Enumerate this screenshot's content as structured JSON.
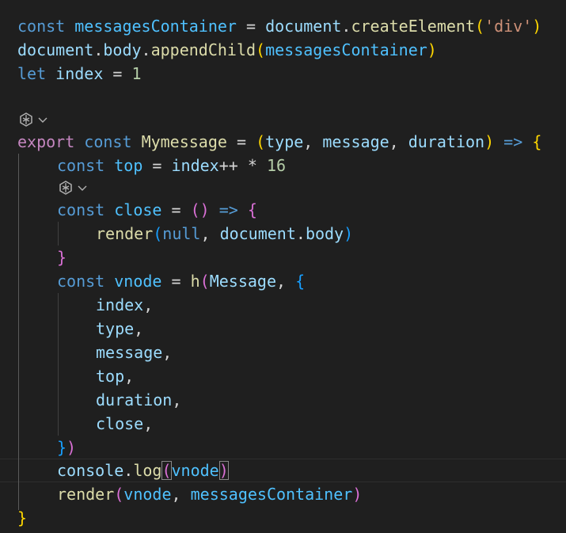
{
  "editor": {
    "line1": {
      "kw": "const",
      "name": "messagesContainer",
      "eq": " = ",
      "obj": "document",
      "dot": ".",
      "fn": "createElement",
      "open": "(",
      "str": "'div'",
      "close": ")"
    },
    "line2": {
      "obj": "document",
      "dot1": ".",
      "prop": "body",
      "dot2": ".",
      "fn": "appendChild",
      "open": "(",
      "arg": "messagesContainer",
      "close": ")"
    },
    "line3": {
      "kw": "let",
      "name": "index",
      "eq": " = ",
      "num": "1"
    },
    "line5": {
      "kw1": "export",
      "kw2": "const",
      "name": "Mymessage",
      "eq": " = ",
      "open": "(",
      "p1": "type",
      "c1": ", ",
      "p2": "message",
      "c2": ", ",
      "p3": "duration",
      "close": ")",
      "arrow": " => ",
      "brace": "{"
    },
    "line6": {
      "kw": "const",
      "name": "top",
      "eq": " = ",
      "var": "index",
      "op": "++ * ",
      "num": "16"
    },
    "line7": {
      "kw": "const",
      "name": "close",
      "eq": " = ",
      "parens": "()",
      "arrow": " => ",
      "brace": "{"
    },
    "line8": {
      "fn": "render",
      "open": "(",
      "kw": "null",
      "c": ", ",
      "obj": "document",
      "dot": ".",
      "prop": "body",
      "close": ")"
    },
    "line9": {
      "brace": "}"
    },
    "line10": {
      "kw": "const",
      "name": "vnode",
      "eq": " = ",
      "fn": "h",
      "open": "(",
      "cls": "Message",
      "c": ", ",
      "brace": "{"
    },
    "props": [
      "index",
      "type",
      "message",
      "top",
      "duration",
      "close"
    ],
    "comma": ",",
    "line17": {
      "brace": "}",
      "paren": ")"
    },
    "line18": {
      "obj": "console",
      "dot": ".",
      "fn": "log",
      "open": "(",
      "arg": "vnode",
      "close": ")"
    },
    "line19": {
      "fn": "render",
      "open": "(",
      "a1": "vnode",
      "c": ", ",
      "a2": "messagesContainer",
      "close": ")"
    },
    "line20": {
      "brace": "}"
    },
    "codelens_icon": "copilot-icon",
    "codelens_chevron": "chevron-down-icon"
  }
}
